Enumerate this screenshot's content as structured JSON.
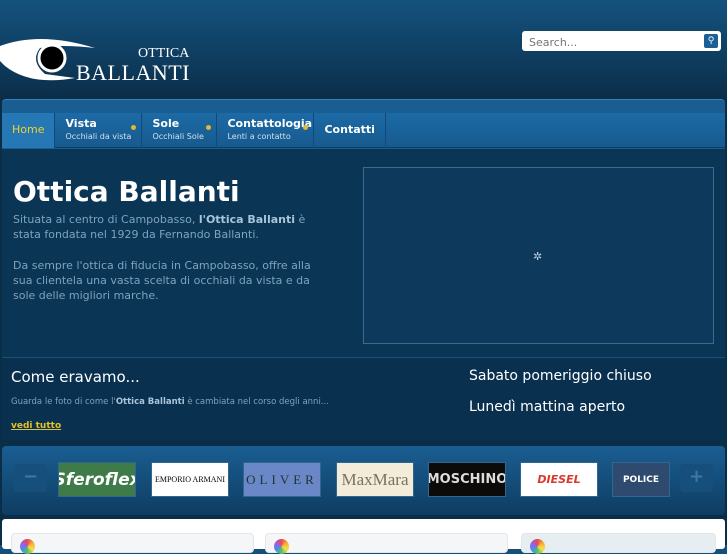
{
  "header": {
    "logo_line1": "OTTICA",
    "logo_line2": "BALLANTI",
    "search_placeholder": "Search..."
  },
  "nav": [
    {
      "label": "Home"
    },
    {
      "label": "Vista",
      "sub": "Occhiali da vista"
    },
    {
      "label": "Sole",
      "sub": "Occhiali Sole"
    },
    {
      "label": "Contattologia",
      "sub": "Lenti a contatto"
    },
    {
      "label": "Contatti"
    }
  ],
  "intro": {
    "title": "Ottica Ballanti",
    "p1_a": "Situata al centro di Campobasso, ",
    "p1_b": "l'Ottica Ballanti",
    "p1_c": " è stata fondata nel 1929 da Fernando Ballanti.",
    "p2": "Da sempre l'ottica di fiducia in Campobasso, offre alla sua clientela una vasta scelta di occhiali da vista e da sole delle migliori marche."
  },
  "come": {
    "title": "Come eravamo...",
    "text_a": "Guarda le foto di come l'",
    "text_b": "Ottica Ballanti",
    "text_c": " è cambiata nel corso degli anni...",
    "link": "vedi tutto"
  },
  "hours": [
    "Sabato pomeriggio chiuso",
    "Lunedì mattina aperto"
  ],
  "brands": {
    "prev": "−",
    "next": "+",
    "items": [
      "Sferoflex",
      "EMPORIO ARMANI",
      "OLIVER",
      "MaxMara",
      "MOSCHINO",
      "DIESEL",
      "POLICE"
    ]
  }
}
